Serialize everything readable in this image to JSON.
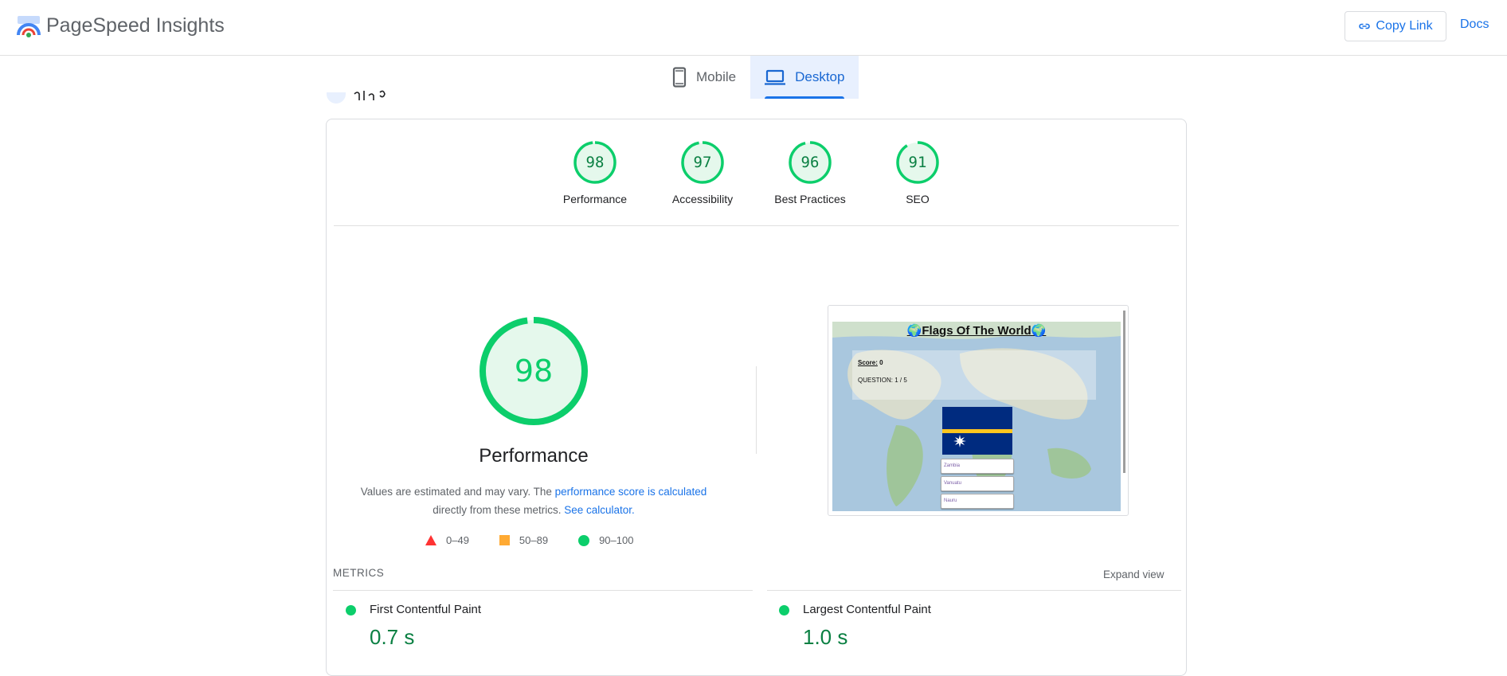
{
  "header": {
    "app_title": "PageSpeed Insights",
    "copy_link_label": "Copy Link",
    "docs_label": "Docs"
  },
  "tabs": [
    {
      "label": "Mobile",
      "active": false
    },
    {
      "label": "Desktop",
      "active": true
    }
  ],
  "categories": [
    {
      "label": "Performance",
      "score": 98
    },
    {
      "label": "Accessibility",
      "score": 97
    },
    {
      "label": "Best Practices",
      "score": 96
    },
    {
      "label": "SEO",
      "score": 91
    }
  ],
  "performance": {
    "score": 98,
    "title": "Performance",
    "desc_prefix": "Values are estimated and may vary. The ",
    "desc_link": "performance score is calculated",
    "desc_middle": "directly from these metrics. ",
    "desc_calc_link": "See calculator."
  },
  "legend": [
    {
      "range": "0–49",
      "shape": "triangle",
      "color": "#ff3333"
    },
    {
      "range": "50–89",
      "shape": "square",
      "color": "#ffaa33"
    },
    {
      "range": "90–100",
      "shape": "circle",
      "color": "#0cce6b"
    }
  ],
  "screenshot": {
    "title": "🌍Flags Of The World🌍",
    "score_label": "Score:",
    "score_value": "0",
    "question": "QUESTION: 1 / 5",
    "answers": [
      "Zambia",
      "Vanuatu",
      "Nauru"
    ]
  },
  "metrics": {
    "heading": "METRICS",
    "expand_label": "Expand view",
    "items": [
      {
        "name": "First Contentful Paint",
        "value": "0.7 s"
      },
      {
        "name": "Largest Contentful Paint",
        "value": "1.0 s"
      }
    ]
  },
  "colors": {
    "accent": "#1a73e8",
    "pass": "#0cce6b",
    "pass_text": "#0b8043",
    "pass_bg": "#e5f8ec"
  }
}
